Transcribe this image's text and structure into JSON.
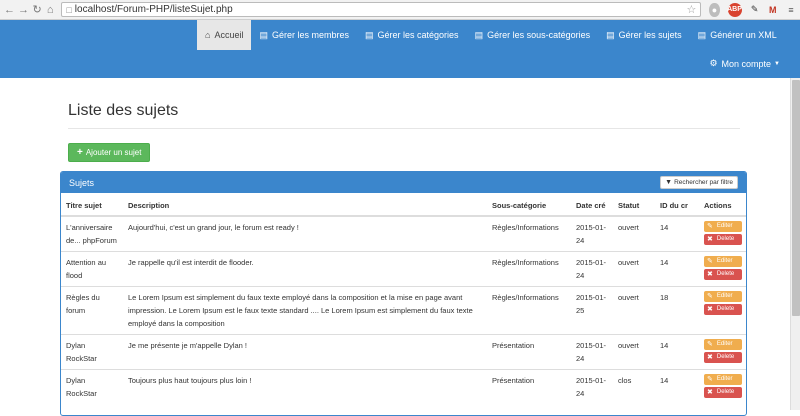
{
  "browser": {
    "url": "localhost/Forum-PHP/listeSujet.php",
    "icons": [
      "back-icon",
      "forward-icon",
      "reload-icon",
      "home-icon",
      "star-icon"
    ]
  },
  "navbar": {
    "items": [
      {
        "label": "Accueil",
        "icon": "home-icon",
        "active": true
      },
      {
        "label": "Gérer les membres",
        "icon": "list-icon"
      },
      {
        "label": "Gérer les catégories",
        "icon": "list-icon"
      },
      {
        "label": "Gérer les sous-catégories",
        "icon": "list-icon"
      },
      {
        "label": "Gérer les sujets",
        "icon": "list-icon"
      },
      {
        "label": "Générer un XML",
        "icon": "list-icon"
      }
    ],
    "account_label": "Mon compte"
  },
  "page": {
    "title": "Liste des sujets",
    "add_button": "Ajouter un sujet"
  },
  "panel": {
    "title": "Sujets",
    "filter_button": "Rechercher par filtre",
    "columns": [
      "Titre sujet",
      "Description",
      "Sous-catégorie",
      "Date cré",
      "Statut",
      "ID du cr",
      "Actions"
    ],
    "edit_label": "Editer",
    "delete_label": "Delete",
    "rows": [
      {
        "titre": "L'anniversaire de... phpForum",
        "description": "Aujourd'hui, c'est un grand jour, le forum est ready !",
        "souscat": "Règles/Informations",
        "date": "2015-01-24",
        "statut": "ouvert",
        "id": "14"
      },
      {
        "titre": "Attention au flood",
        "description": "Je rappelle qu'il est interdit de flooder.",
        "souscat": "Règles/Informations",
        "date": "2015-01-24",
        "statut": "ouvert",
        "id": "14"
      },
      {
        "titre": "Règles du forum",
        "description": "Le Lorem Ipsum est simplement du faux texte employé dans la composition et la mise en page avant impression. Le Lorem Ipsum est le faux texte standard .... Le Lorem Ipsum est simplement du faux texte employé dans la composition",
        "souscat": "Règles/Informations",
        "date": "2015-01-25",
        "statut": "ouvert",
        "id": "18"
      },
      {
        "titre": "Dylan RockStar",
        "description": "Je me présente je m'appelle Dylan !",
        "souscat": "Présentation",
        "date": "2015-01-24",
        "statut": "ouvert",
        "id": "14"
      },
      {
        "titre": "Dylan RockStar",
        "description": "Toujours plus haut toujours plus loin !",
        "souscat": "Présentation",
        "date": "2015-01-24",
        "statut": "clos",
        "id": "14"
      }
    ]
  },
  "colors": {
    "primary": "#3b86cc",
    "success": "#5cb85c",
    "warning": "#f0ad4e",
    "danger": "#d9534f"
  }
}
